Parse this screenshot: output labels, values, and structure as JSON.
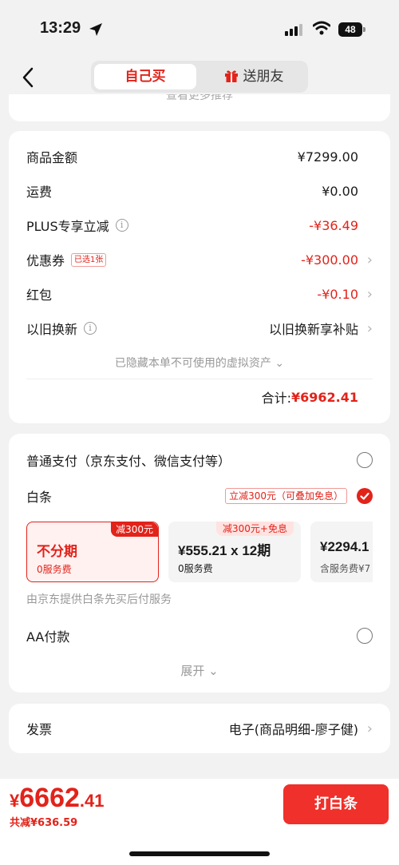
{
  "status": {
    "time": "13:29",
    "battery": "48"
  },
  "nav": {
    "tab_self": "自己买",
    "tab_gift": "送朋友"
  },
  "peek": {
    "text": "查看更多推荐"
  },
  "summary": {
    "rows": [
      {
        "label": "商品金额",
        "value": "¥7299.00"
      },
      {
        "label": "运费",
        "value": "¥0.00"
      },
      {
        "label": "PLUS专享立减",
        "value": "-¥36.49"
      },
      {
        "label": "优惠券",
        "tag": "已选1张",
        "value": "-¥300.00"
      },
      {
        "label": "红包",
        "value": "-¥0.10"
      },
      {
        "label": "以旧换新",
        "value": "以旧换新享补贴"
      }
    ],
    "hidden_assets": "已隐藏本单不可使用的虚拟资产",
    "total_label": "合计:",
    "total_value": "¥6962.41"
  },
  "payment": {
    "normal_label": "普通支付（京东支付、微信支付等）",
    "baitiao_label": "白条",
    "baitiao_promo": "立减300元（可叠加免息）",
    "plans": [
      {
        "title": "不分期",
        "sub": "0服务费",
        "badge": "减300元"
      },
      {
        "title": "¥555.21 x 12期",
        "sub": "0服务费",
        "badge": "减300元+免息"
      },
      {
        "title": "¥2294.1",
        "sub": "含服务费¥7"
      }
    ],
    "provider_note": "由京东提供白条先买后付服务",
    "aa_label": "AA付款",
    "expand_label": "展开"
  },
  "invoice": {
    "label": "发票",
    "value": "电子(商品明细-廖子健)"
  },
  "bottom": {
    "currency": "¥",
    "price_int": "6662",
    "price_dec": ".41",
    "saved": "共减¥636.59",
    "pay_button": "打白条"
  },
  "colors": {
    "accent": "#e2231a",
    "button": "#f0302a",
    "background": "#f2f2f2"
  }
}
